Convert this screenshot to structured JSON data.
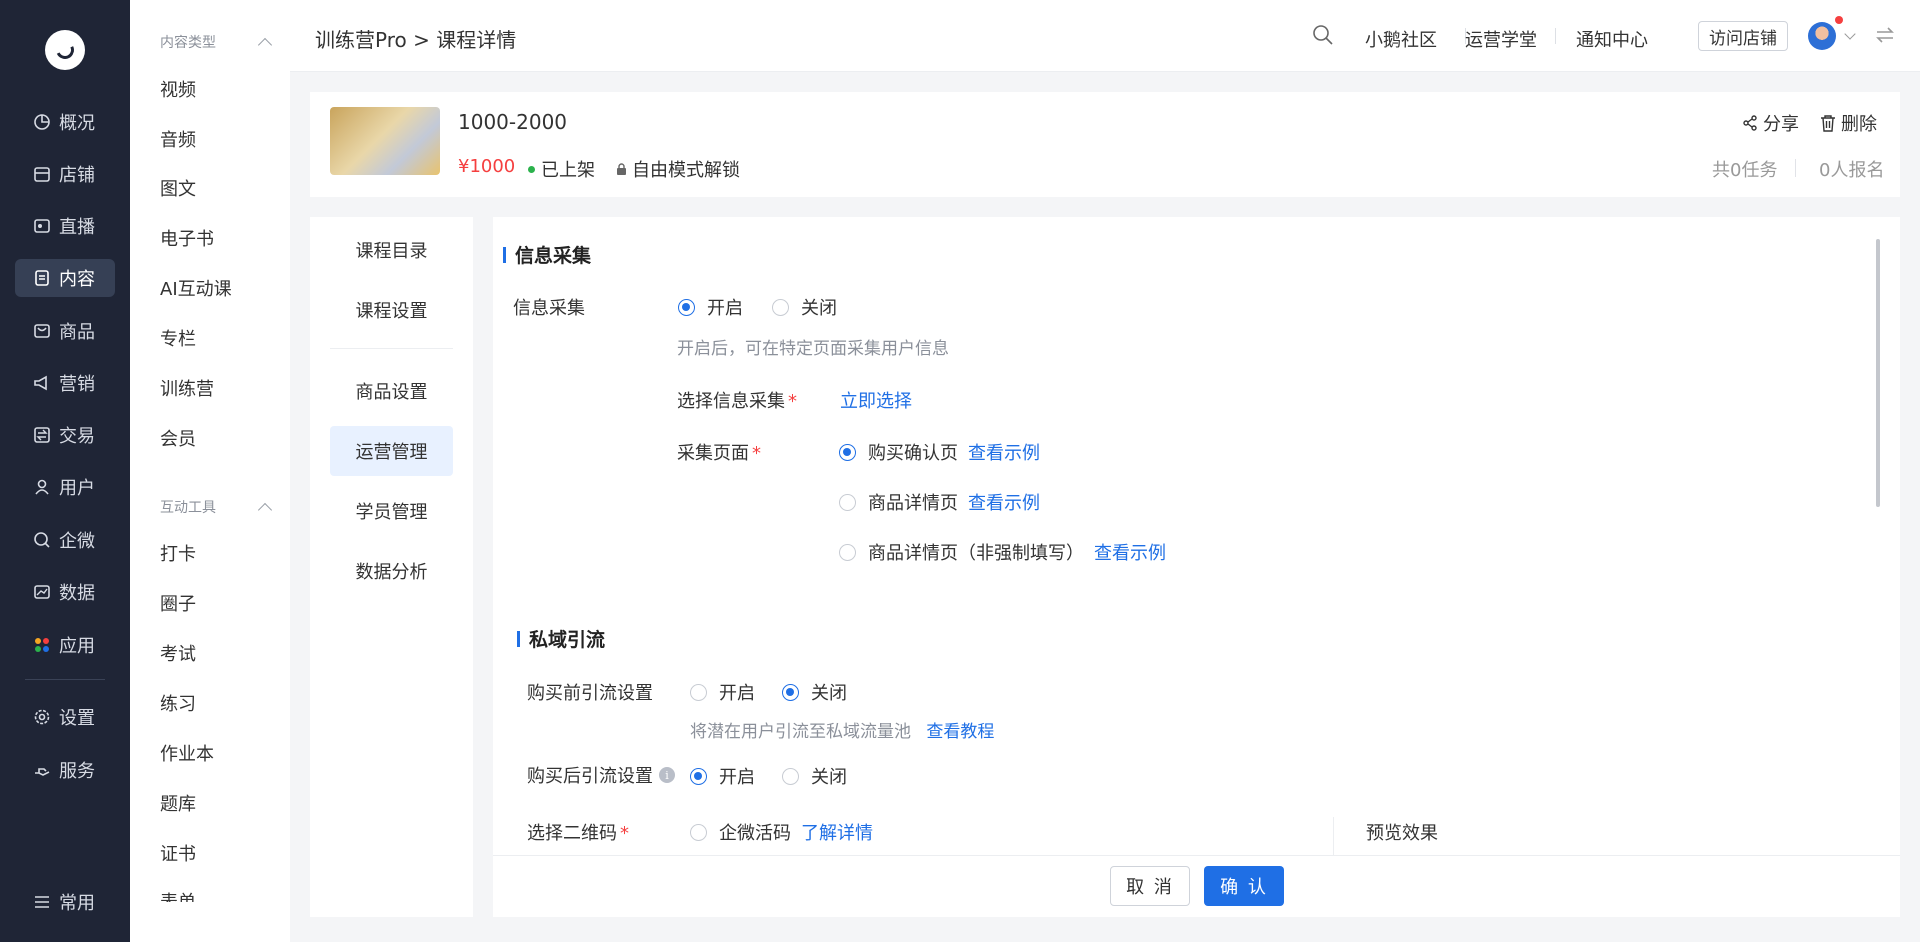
{
  "nav": {
    "items": [
      {
        "label": "概况",
        "icon": "pie-chart-icon"
      },
      {
        "label": "店铺",
        "icon": "store-icon"
      },
      {
        "label": "直播",
        "icon": "live-icon"
      },
      {
        "label": "内容",
        "icon": "content-icon"
      },
      {
        "label": "商品",
        "icon": "goods-icon"
      },
      {
        "label": "营销",
        "icon": "megaphone-icon"
      },
      {
        "label": "交易",
        "icon": "trade-icon"
      },
      {
        "label": "用户",
        "icon": "user-icon"
      },
      {
        "label": "企微",
        "icon": "wecom-icon"
      },
      {
        "label": "数据",
        "icon": "data-icon"
      },
      {
        "label": "应用",
        "icon": "apps-icon"
      },
      {
        "label": "设置",
        "icon": "gear-icon"
      },
      {
        "label": "服务",
        "icon": "service-icon"
      },
      {
        "label": "常用",
        "icon": "list-icon"
      }
    ],
    "active": "内容"
  },
  "secondary_nav": {
    "group1_title": "内容类型",
    "group1_items": [
      "视频",
      "音频",
      "图文",
      "电子书",
      "AI互动课",
      "专栏",
      "训练营",
      "会员"
    ],
    "group2_title": "互动工具",
    "group2_items": [
      "打卡",
      "圈子",
      "考试",
      "练习",
      "作业本",
      "题库",
      "证书",
      "表单"
    ]
  },
  "header": {
    "breadcrumb": "训练营Pro > 课程详情",
    "links": [
      "小鹅社区",
      "运营学堂",
      "通知中心"
    ],
    "visit_store": "访问店铺"
  },
  "course": {
    "title": "1000-2000",
    "price": "¥1000",
    "status": "已上架",
    "unlock_mode": "自由模式解锁",
    "share": "分享",
    "delete": "删除",
    "tasks": "共0任务",
    "signups": "0人报名"
  },
  "side_menu": {
    "items": [
      "课程目录",
      "课程设置",
      "商品设置",
      "运营管理",
      "学员管理",
      "数据分析"
    ],
    "active": "运营管理"
  },
  "info_collect": {
    "section_title": "信息采集",
    "label": "信息采集",
    "on": "开启",
    "off": "关闭",
    "selected": "开启",
    "hint": "开启后，可在特定页面采集用户信息",
    "choose_label": "选择信息采集",
    "choose_link": "立即选择",
    "page_label": "采集页面",
    "pages": [
      {
        "label": "购买确认页",
        "link": "查看示例",
        "checked": true
      },
      {
        "label": "商品详情页",
        "link": "查看示例",
        "checked": false
      },
      {
        "label": "商品详情页（非强制填写）",
        "link": "查看示例",
        "checked": false
      }
    ]
  },
  "private_traffic": {
    "section_title": "私域引流",
    "pre_label": "购买前引流设置",
    "pre_on": "开启",
    "pre_off": "关闭",
    "pre_selected": "关闭",
    "pre_hint": "将潜在用户引流至私域流量池",
    "pre_hint_link": "查看教程",
    "post_label": "购买后引流设置",
    "post_on": "开启",
    "post_off": "关闭",
    "post_selected": "开启",
    "qr_label": "选择二维码",
    "qr_option": "企微活码",
    "qr_link": "了解详情",
    "preview_label": "预览效果"
  },
  "footer": {
    "cancel": "取 消",
    "confirm": "确 认"
  }
}
